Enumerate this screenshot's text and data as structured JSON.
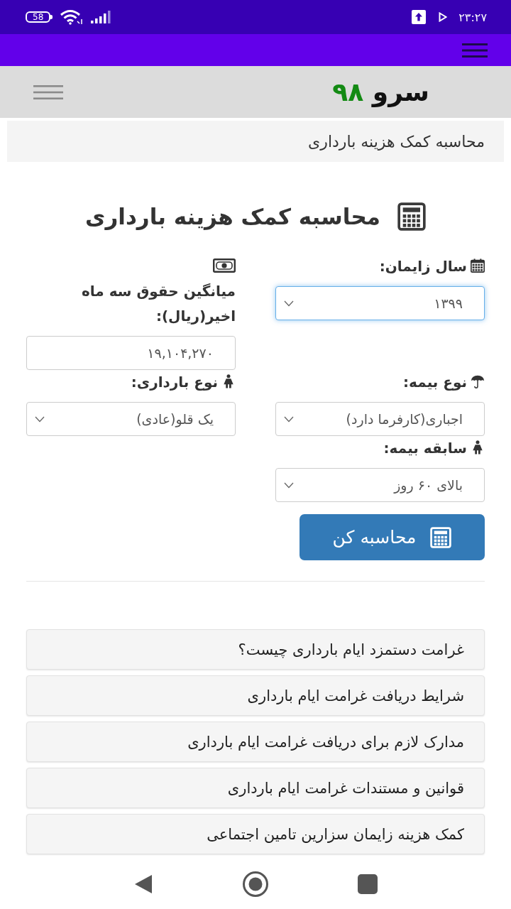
{
  "status_bar": {
    "battery": "58",
    "time": "۲۳:۲۷"
  },
  "site_header": {
    "logo_word": "سرو",
    "logo_number": "۹۸"
  },
  "breadcrumb": "محاسبه کمک هزینه بارداری",
  "heading": "محاسبه کمک هزینه بارداری",
  "form": {
    "fields": [
      {
        "kind": "select",
        "label": "سال زایمان:",
        "value": "۱۳۹۹",
        "focused": true
      },
      {
        "kind": "input",
        "label": "میانگین حقوق سه ماه اخیر(ریال):",
        "value": "۱۹,۱۰۴,۲۷۰",
        "focused": false
      },
      {
        "kind": "select",
        "label": "نوع بیمه:",
        "value": "اجباری(کارفرما دارد)",
        "focused": false
      },
      {
        "kind": "select",
        "label": "نوع بارداری:",
        "value": "یک قلو(عادی)",
        "focused": false
      },
      {
        "kind": "select",
        "label": "سابقه بیمه:",
        "value": "بالای ۶۰ روز",
        "focused": false
      }
    ],
    "submit_button": "محاسبه کن"
  },
  "faq_links": [
    "غرامت دستمزد ایام بارداری چیست؟",
    "شرایط دریافت غرامت ایام بارداری",
    "مدارک لازم برای دریافت غرامت ایام بارداری",
    "قوانین و مستندات غرامت ایام بارداری",
    "کمک هزینه زایمان سزارین تامین اجتماعی"
  ]
}
